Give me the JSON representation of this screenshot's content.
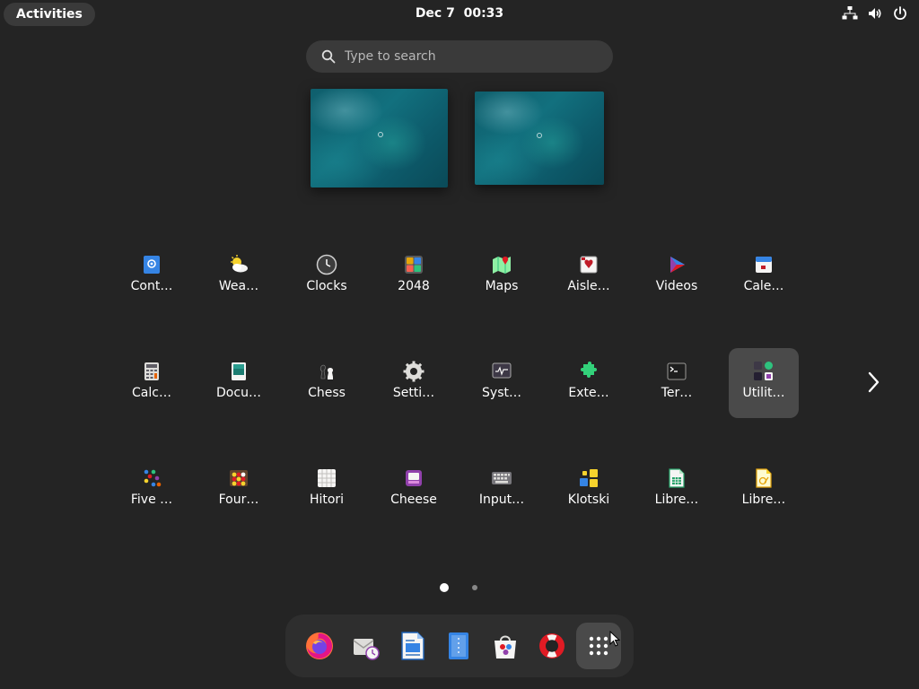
{
  "topbar": {
    "activities_label": "Activities",
    "date": "Dec 7",
    "time": "00:33",
    "tray_icons": [
      "network-icon",
      "volume-icon",
      "power-icon"
    ]
  },
  "search": {
    "placeholder": "Type to search"
  },
  "workspaces": [
    {
      "icon": "workspace-thumbnail"
    },
    {
      "icon": "workspace-thumbnail"
    }
  ],
  "apps": [
    {
      "label": "Cont…",
      "icon": "contacts-icon"
    },
    {
      "label": "Wea…",
      "icon": "weather-icon"
    },
    {
      "label": "Clocks",
      "icon": "clocks-icon"
    },
    {
      "label": "2048",
      "icon": "2048-icon"
    },
    {
      "label": "Maps",
      "icon": "maps-icon"
    },
    {
      "label": "Aisle…",
      "icon": "aisleriot-icon"
    },
    {
      "label": "Videos",
      "icon": "videos-icon"
    },
    {
      "label": "Cale…",
      "icon": "calendar-icon"
    },
    {
      "label": "Calc…",
      "icon": "calculator-icon"
    },
    {
      "label": "Docu…",
      "icon": "document-viewer-icon"
    },
    {
      "label": "Chess",
      "icon": "chess-icon"
    },
    {
      "label": "Setti…",
      "icon": "settings-icon"
    },
    {
      "label": "Syst…",
      "icon": "system-monitor-icon"
    },
    {
      "label": "Exte…",
      "icon": "extensions-icon"
    },
    {
      "label": "Ter…",
      "icon": "terminal-icon"
    },
    {
      "label": "Utilit…",
      "icon": "utilities-folder-icon",
      "selected": true
    },
    {
      "label": "Five …",
      "icon": "five-or-more-icon"
    },
    {
      "label": "Four…",
      "icon": "four-in-a-row-icon"
    },
    {
      "label": "Hitori",
      "icon": "hitori-icon"
    },
    {
      "label": "Cheese",
      "icon": "cheese-icon"
    },
    {
      "label": "Input…",
      "icon": "input-method-icon"
    },
    {
      "label": "Klotski",
      "icon": "klotski-icon"
    },
    {
      "label": "Libre…",
      "icon": "libreoffice-calc-icon"
    },
    {
      "label": "Libre…",
      "icon": "libreoffice-draw-icon"
    }
  ],
  "pagination": {
    "pages": 2,
    "current": 1
  },
  "dock": [
    {
      "icon": "firefox-icon"
    },
    {
      "icon": "evolution-mail-icon"
    },
    {
      "icon": "libreoffice-writer-icon"
    },
    {
      "icon": "text-editor-icon"
    },
    {
      "icon": "software-store-icon"
    },
    {
      "icon": "help-icon"
    },
    {
      "icon": "show-apps-icon",
      "active": true
    }
  ],
  "colors": {
    "background": "#242424",
    "panel": "#3a3a3a",
    "dock": "#2e2e2e",
    "selected": "#4a4a4a"
  }
}
